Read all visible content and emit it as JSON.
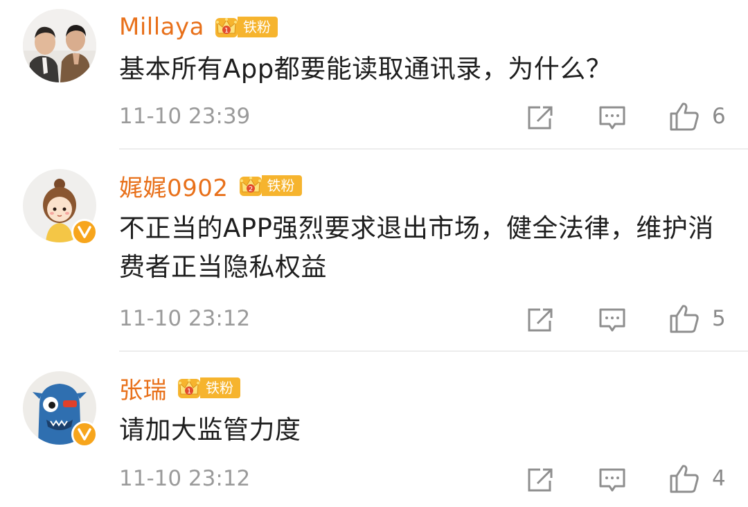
{
  "comments": [
    {
      "username": "Millaya",
      "fan_badge": "铁粉",
      "fan_level": "1",
      "verified": false,
      "text": "基本所有App都要能读取通讯录，为什么？",
      "time": "11-10 23:39",
      "likes": "6",
      "avatar": "two-men-photo-avatar"
    },
    {
      "username": "娓娓0902",
      "fan_badge": "铁粉",
      "fan_level": "2",
      "verified": true,
      "text": "不正当的APP强烈要求退出市场，健全法律，维护消费者正当隐私权益",
      "time": "11-10 23:12",
      "likes": "5",
      "avatar": "cartoon-girl-avatar"
    },
    {
      "username": "张瑞",
      "fan_badge": "铁粉",
      "fan_level": "1",
      "verified": true,
      "text": "请加大监管力度",
      "time": "11-10 23:12",
      "likes": "4",
      "avatar": "blue-monster-avatar"
    }
  ],
  "icons": {
    "share": "share-icon",
    "comment": "comment-icon",
    "like": "thumbs-up-icon",
    "verified": "verified-v-icon",
    "crown": "crown-icon"
  },
  "colors": {
    "username": "#e8701a",
    "fan_badge": "#f6b42e",
    "verified": "#f7a51c",
    "meta": "#9a9a9a"
  }
}
